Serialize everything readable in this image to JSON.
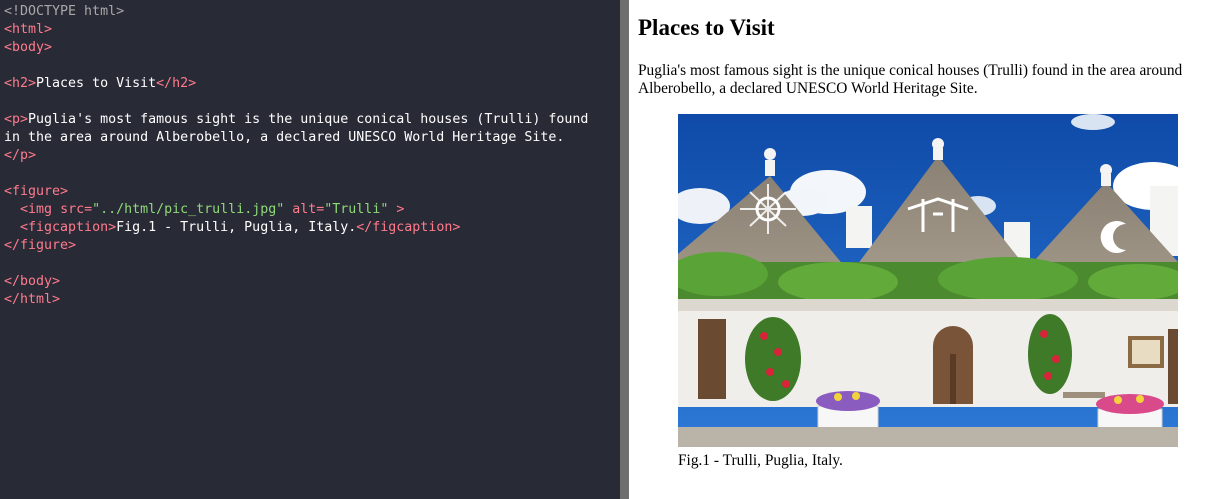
{
  "editor": {
    "lines": [
      [
        {
          "c": "doctype",
          "t": "<!DOCTYPE html>"
        }
      ],
      [
        {
          "c": "tag",
          "t": "<html>"
        }
      ],
      [
        {
          "c": "tag",
          "t": "<body>"
        }
      ],
      [],
      [
        {
          "c": "tag",
          "t": "<h2>"
        },
        {
          "c": "text",
          "t": "Places to Visit"
        },
        {
          "c": "tag",
          "t": "</h2>"
        }
      ],
      [],
      [
        {
          "c": "tag",
          "t": "<p>"
        },
        {
          "c": "text",
          "t": "Puglia's most famous sight is the unique conical houses (Trulli) found"
        }
      ],
      [
        {
          "c": "text",
          "t": "in the area around Alberobello, a declared UNESCO World Heritage Site."
        }
      ],
      [
        {
          "c": "tag",
          "t": "</p>"
        }
      ],
      [],
      [
        {
          "c": "tag",
          "t": "<figure>"
        }
      ],
      [
        {
          "c": "text",
          "t": "  "
        },
        {
          "c": "tag",
          "t": "<img"
        },
        {
          "c": "text",
          "t": " "
        },
        {
          "c": "attr",
          "t": "src="
        },
        {
          "c": "val",
          "t": "\"../html/pic_trulli.jpg\""
        },
        {
          "c": "text",
          "t": " "
        },
        {
          "c": "attr",
          "t": "alt="
        },
        {
          "c": "val",
          "t": "\"Trulli\""
        },
        {
          "c": "text",
          "t": " "
        },
        {
          "c": "tag",
          "t": ">"
        }
      ],
      [
        {
          "c": "text",
          "t": "  "
        },
        {
          "c": "tag",
          "t": "<figcaption>"
        },
        {
          "c": "text",
          "t": "Fig.1 - Trulli, Puglia, Italy."
        },
        {
          "c": "tag",
          "t": "</figcaption>"
        }
      ],
      [
        {
          "c": "tag",
          "t": "</figure>"
        }
      ],
      [],
      [
        {
          "c": "tag",
          "t": "</body>"
        }
      ],
      [
        {
          "c": "tag",
          "t": "</html>"
        }
      ]
    ]
  },
  "result": {
    "heading": "Places to Visit",
    "paragraph": "Puglia's most famous sight is the unique conical houses (Trulli) found in the area around Alberobello, a declared UNESCO World Heritage Site.",
    "image_alt": "Trulli",
    "caption": "Fig.1 - Trulli, Puglia, Italy."
  },
  "colors": {
    "editor_bg": "#282a36",
    "tag": "#ff7b8c",
    "attr_value": "#8fd977",
    "doctype": "#a8a8a8",
    "divider": "#6e6e6e"
  }
}
